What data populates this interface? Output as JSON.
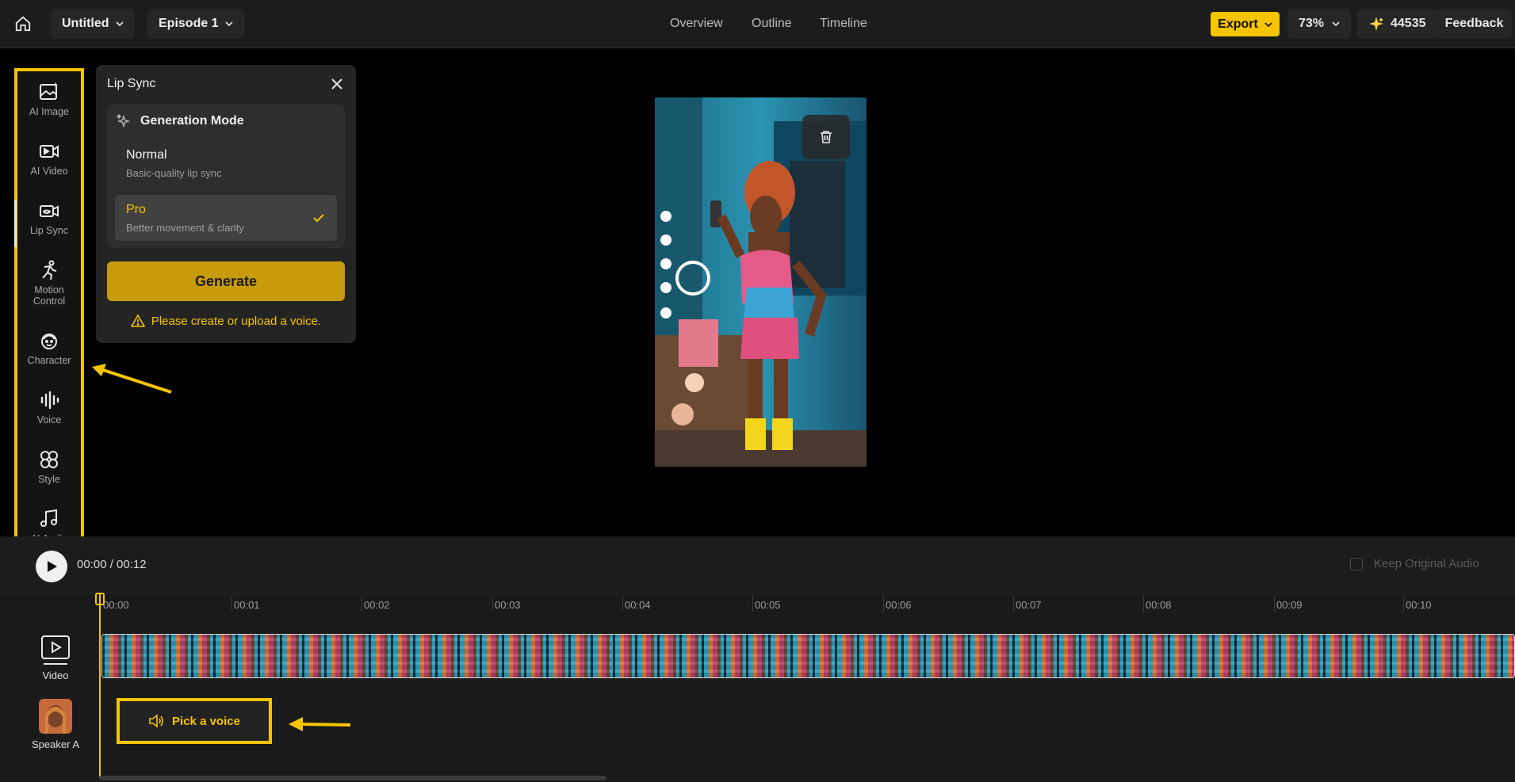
{
  "topbar": {
    "project": "Untitled",
    "episode": "Episode 1",
    "nav": [
      "Overview",
      "Outline",
      "Timeline"
    ],
    "export_label": "Export",
    "zoom": "73%",
    "credits": "44535",
    "feedback": "Feedback"
  },
  "tools": [
    {
      "label": "AI Image",
      "icon": "ai-image-icon"
    },
    {
      "label": "AI Video",
      "icon": "ai-video-icon"
    },
    {
      "label": "Lip Sync",
      "icon": "lip-sync-icon"
    },
    {
      "label": "Motion Control",
      "icon": "motion-control-icon"
    },
    {
      "label": "Character",
      "icon": "character-icon"
    },
    {
      "label": "Voice",
      "icon": "voice-icon"
    },
    {
      "label": "Style",
      "icon": "style-icon"
    },
    {
      "label": "AI Audio",
      "icon": "ai-audio-icon"
    }
  ],
  "panel": {
    "title": "Lip Sync",
    "mode_heading": "Generation Mode",
    "options": [
      {
        "title": "Normal",
        "subtitle": "Basic-quality lip sync",
        "selected": false
      },
      {
        "title": "Pro",
        "subtitle": "Better movement & clarity",
        "selected": true
      }
    ],
    "generate_label": "Generate",
    "warning": "Please create or upload a voice."
  },
  "player": {
    "time": "00:00 / 00:12",
    "keep_original_audio": "Keep Original Audio"
  },
  "timeline": {
    "ticks": [
      "00:00",
      "00:01",
      "00:02",
      "00:03",
      "00:04",
      "00:05",
      "00:06",
      "00:07",
      "00:08",
      "00:09",
      "00:10"
    ],
    "video_track_label": "Video",
    "speaker_track_label": "Speaker A",
    "pick_voice_label": "Pick a voice"
  },
  "colors": {
    "accent": "#f7c400",
    "background": "#000000",
    "panel": "#242424"
  }
}
